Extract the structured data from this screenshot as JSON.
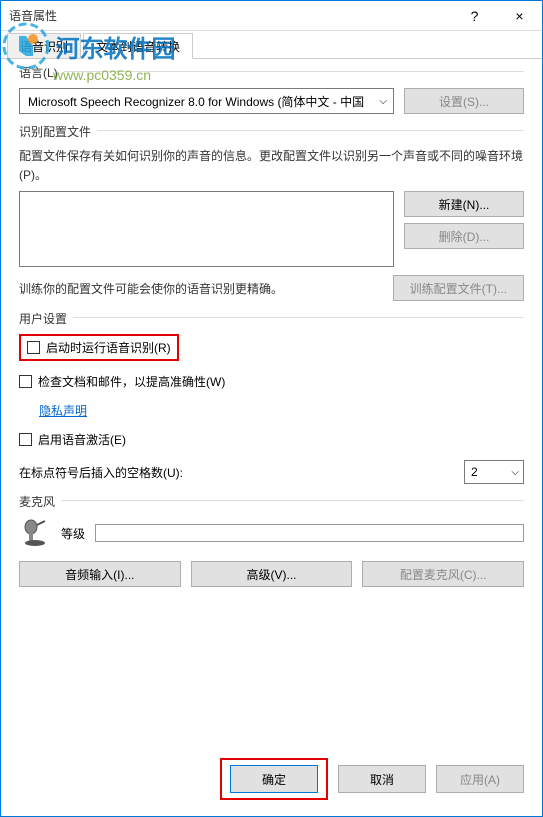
{
  "window": {
    "title": "语音属性",
    "help_icon": "?",
    "close_icon": "×"
  },
  "watermark": {
    "text": "河东软件园",
    "url": "www.pc0359.cn"
  },
  "tabs": {
    "tab1": "语音识别",
    "tab2": "文本到语音转换"
  },
  "language": {
    "legend": "语言(L)",
    "selected": "Microsoft Speech Recognizer 8.0 for Windows (简体中文 - 中国",
    "settings_btn": "设置(S)..."
  },
  "profile": {
    "legend": "识别配置文件",
    "desc": "配置文件保存有关如何识别你的声音的信息。更改配置文件以识别另一个声音或不同的噪音环境(P)。",
    "new_btn": "新建(N)...",
    "delete_btn": "删除(D)...",
    "train_text": "训练你的配置文件可能会使你的语音识别更精确。",
    "train_btn": "训练配置文件(T)..."
  },
  "user_settings": {
    "legend": "用户设置",
    "run_at_startup": "启动时运行语音识别(R)",
    "review_docs": "检查文档和邮件，以提高准确性(W)",
    "privacy_link": "隐私声明",
    "enable_voice_activate": "启用语音激活(E)",
    "spaces_label": "在标点符号后插入的空格数(U):",
    "spaces_value": "2"
  },
  "microphone": {
    "legend": "麦克风",
    "level_label": "等级",
    "audio_input_btn": "音频输入(I)...",
    "advanced_btn": "高级(V)...",
    "config_mic_btn": "配置麦克风(C)..."
  },
  "footer": {
    "ok": "确定",
    "cancel": "取消",
    "apply": "应用(A)"
  }
}
